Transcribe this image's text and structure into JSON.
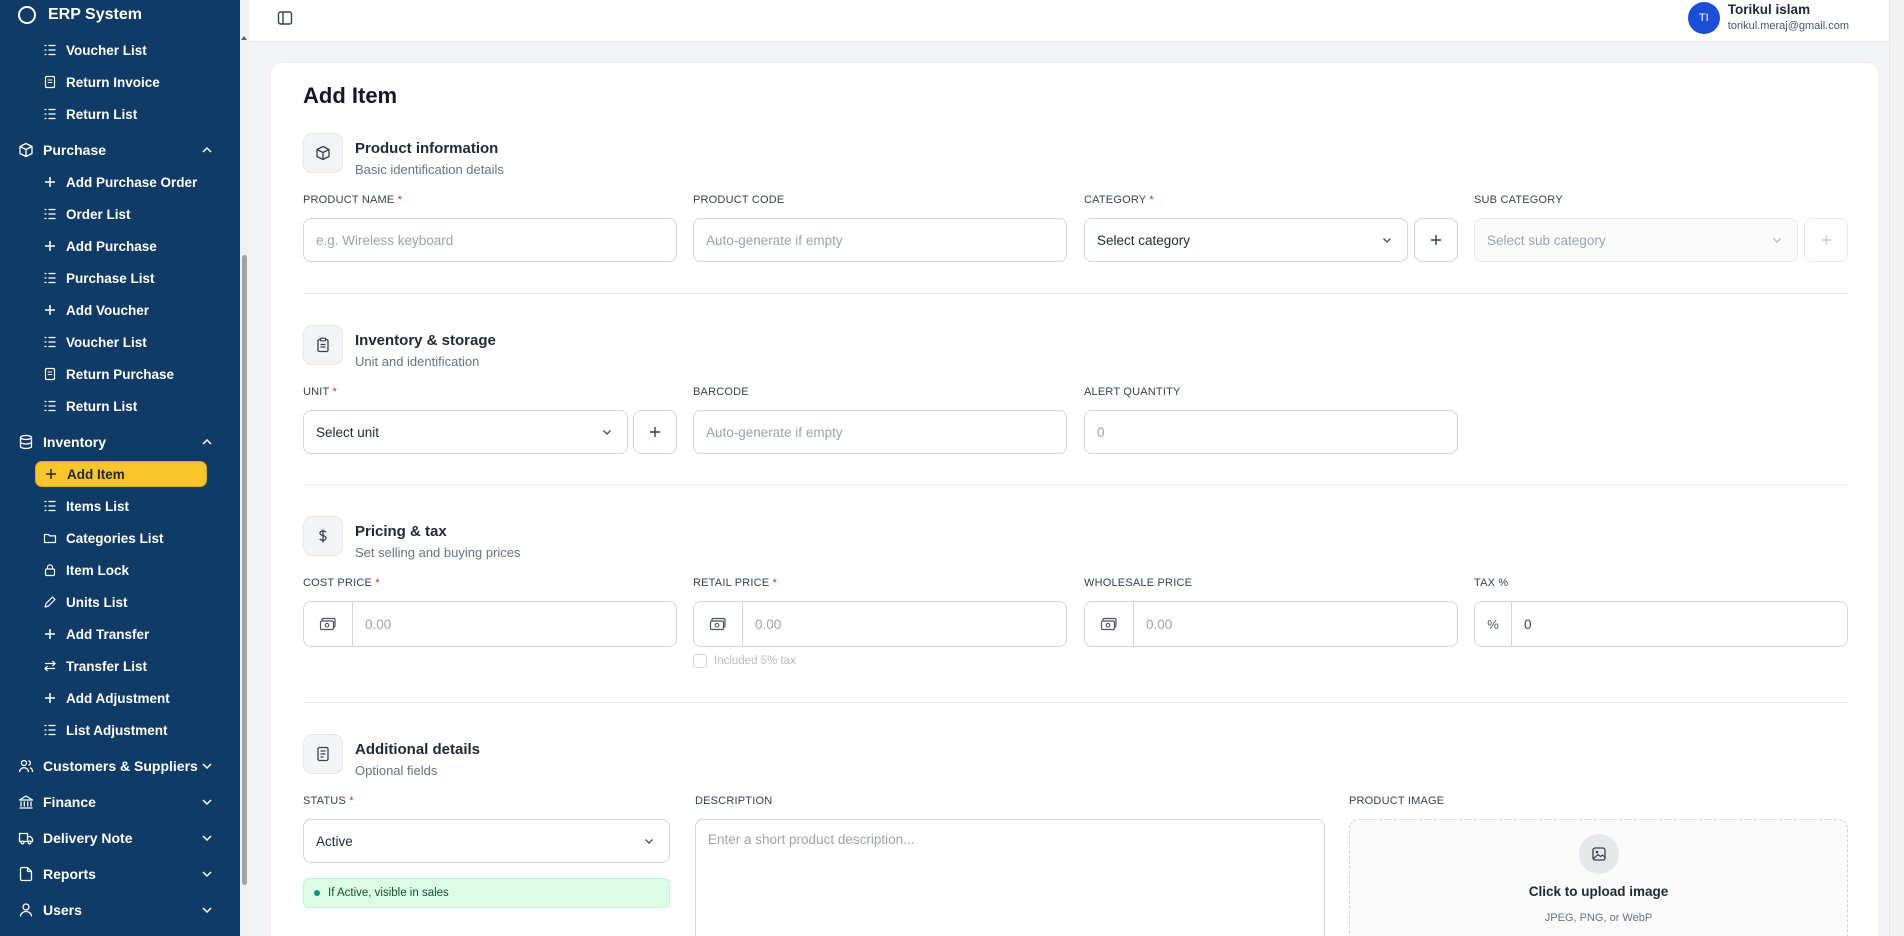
{
  "app": {
    "title": "ERP System"
  },
  "sidebar": {
    "top_items": [
      {
        "label": "Voucher List",
        "icon": "list-icon"
      },
      {
        "label": "Return Invoice",
        "icon": "document-icon"
      },
      {
        "label": "Return List",
        "icon": "list-icon"
      }
    ],
    "purchase": {
      "label": "Purchase",
      "items": [
        {
          "label": "Add Purchase Order",
          "icon": "plus-icon"
        },
        {
          "label": "Order List",
          "icon": "list-icon"
        },
        {
          "label": "Add Purchase",
          "icon": "plus-icon"
        },
        {
          "label": "Purchase List",
          "icon": "list-icon"
        },
        {
          "label": "Add Voucher",
          "icon": "plus-icon"
        },
        {
          "label": "Voucher List",
          "icon": "list-icon"
        },
        {
          "label": "Return Purchase",
          "icon": "document-icon"
        },
        {
          "label": "Return List",
          "icon": "list-icon"
        }
      ]
    },
    "inventory": {
      "label": "Inventory",
      "items": [
        {
          "label": "Add Item",
          "icon": "plus-icon",
          "active": true
        },
        {
          "label": "Items List",
          "icon": "list-icon"
        },
        {
          "label": "Categories List",
          "icon": "folder-icon"
        },
        {
          "label": "Item Lock",
          "icon": "lock-icon"
        },
        {
          "label": "Units List",
          "icon": "pencil-icon"
        },
        {
          "label": "Add Transfer",
          "icon": "plus-icon"
        },
        {
          "label": "Transfer List",
          "icon": "transfer-icon"
        },
        {
          "label": "Add Adjustment",
          "icon": "plus-icon"
        },
        {
          "label": "List Adjustment",
          "icon": "list-icon"
        }
      ]
    },
    "groups": [
      {
        "label": "Customers & Suppliers",
        "icon": "users-icon"
      },
      {
        "label": "Finance",
        "icon": "bank-icon"
      },
      {
        "label": "Delivery Note",
        "icon": "truck-icon"
      },
      {
        "label": "Reports",
        "icon": "report-icon"
      },
      {
        "label": "Users",
        "icon": "user-icon"
      }
    ],
    "active_color": "#f8c52b",
    "bg_color": "#0f3b66"
  },
  "header": {
    "user": {
      "initials": "TI",
      "name": "Torikul islam",
      "email": "torikul.meraj@gmail.com"
    }
  },
  "page": {
    "title": "Add Item",
    "product_info": {
      "title": "Product information",
      "subtitle": "Basic identification details",
      "product_name": {
        "label": "PRODUCT NAME",
        "placeholder": "e.g. Wireless keyboard"
      },
      "product_code": {
        "label": "PRODUCT CODE",
        "placeholder": "Auto-generate if empty"
      },
      "category": {
        "label": "CATEGORY",
        "value": "Select category"
      },
      "sub_category": {
        "label": "SUB CATEGORY",
        "value": "Select sub category"
      }
    },
    "inventory": {
      "title": "Inventory & storage",
      "subtitle": "Unit and identification",
      "unit": {
        "label": "UNIT",
        "value": "Select unit"
      },
      "barcode": {
        "label": "BARCODE",
        "placeholder": "Auto-generate if empty"
      },
      "alert_quantity": {
        "label": "ALERT QUANTITY",
        "value": "0"
      }
    },
    "pricing": {
      "title": "Pricing & tax",
      "subtitle": "Set selling and buying prices",
      "cost_price": {
        "label": "COST PRICE",
        "placeholder": "0.00"
      },
      "retail_price": {
        "label": "RETAIL PRICE",
        "placeholder": "0.00"
      },
      "included_tax": "Included 5% tax",
      "wholesale_price": {
        "label": "WHOLESALE PRICE",
        "placeholder": "0.00"
      },
      "tax": {
        "label": "TAX %",
        "prefix": "%",
        "value": "0"
      }
    },
    "additional": {
      "title": "Additional details",
      "subtitle": "Optional fields",
      "status": {
        "label": "STATUS",
        "value": "Active",
        "hint": "If Active, visible in sales"
      },
      "description": {
        "label": "DESCRIPTION",
        "placeholder": "Enter a short product description..."
      },
      "image": {
        "label": "PRODUCT IMAGE",
        "title": "Click to upload image",
        "formats": "JPEG, PNG, or WebP"
      }
    }
  }
}
